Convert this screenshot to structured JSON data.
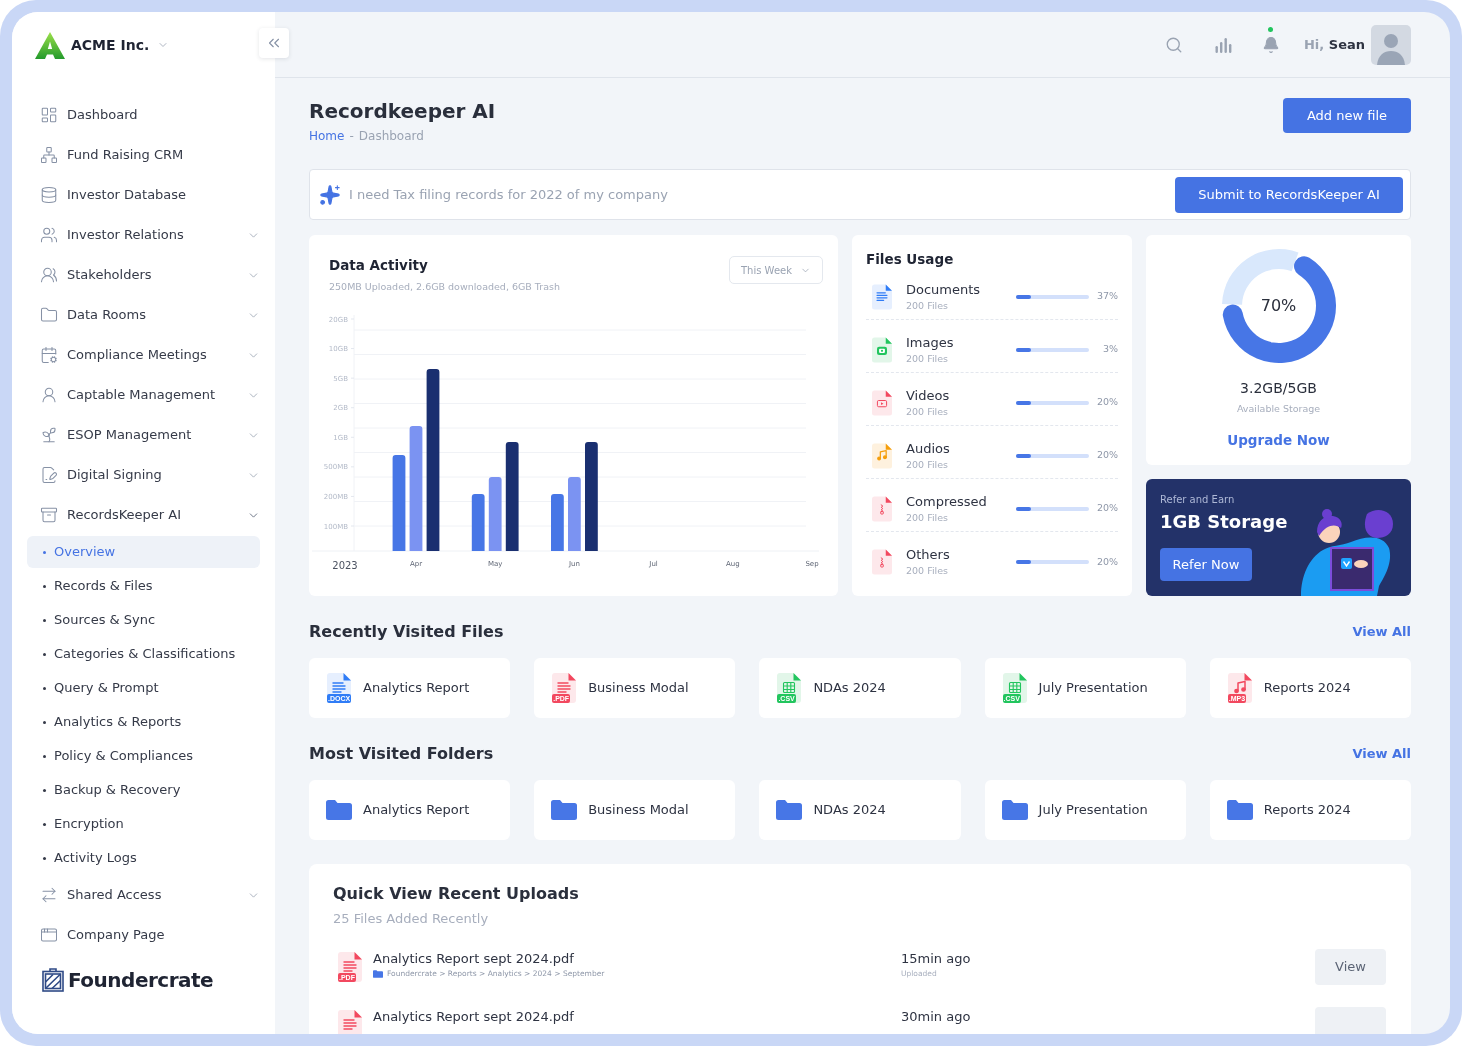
{
  "sidebar": {
    "brand": "ACME Inc.",
    "items": [
      {
        "label": "Dashboard",
        "selected": false
      },
      {
        "label": "Fund Raising CRM",
        "selected": false
      },
      {
        "label": "Investor Database",
        "selected": false
      },
      {
        "label": "Investor Relations",
        "selected": false,
        "expanded": false
      },
      {
        "label": "Stakeholders",
        "selected": false,
        "expanded": false
      },
      {
        "label": "Data Rooms",
        "selected": false,
        "expanded": false
      },
      {
        "label": "Compliance Meetings",
        "selected": false,
        "expanded": false
      },
      {
        "label": "Captable Management",
        "selected": false,
        "expanded": false
      },
      {
        "label": "ESOP Management",
        "selected": false,
        "expanded": false
      },
      {
        "label": "Digital Signing",
        "selected": false,
        "expanded": false
      },
      {
        "label": "RecordsKeeper AI",
        "selected": false,
        "expanded": true,
        "children": [
          {
            "label": "Overview",
            "selected": true
          },
          {
            "label": "Records & Files",
            "selected": false
          },
          {
            "label": "Sources & Sync",
            "selected": false
          },
          {
            "label": "Categories & Classifications",
            "selected": false
          },
          {
            "label": "Query & Prompt",
            "selected": false
          },
          {
            "label": "Analytics & Reports",
            "selected": false
          },
          {
            "label": "Policy & Compliances",
            "selected": false
          },
          {
            "label": "Backup & Recovery",
            "selected": false
          },
          {
            "label": "Encryption",
            "selected": false
          },
          {
            "label": "Activity Logs",
            "selected": false
          }
        ]
      },
      {
        "label": "Shared Access",
        "selected": false,
        "expanded": false
      },
      {
        "label": "Company Page",
        "selected": false
      }
    ],
    "footer_logo": "Foundercrate"
  },
  "header": {
    "notification_dot": true,
    "greeting": "Hi, **Sean**"
  },
  "page": {
    "title": "Recordkeeper AI",
    "breadcrumb": [
      "Home",
      "Dashboard"
    ],
    "breadcrumb_separator": "-",
    "button": "Add new file"
  },
  "prompt": {
    "placeholder": "I need Tax filing records for 2022 of my company",
    "button": "Submit to RecordsKeeper AI"
  },
  "data_activity": {
    "title": "Data Activity",
    "subtitle": "250MB Uploaded, 2.6GB downloaded, 6GB Trash",
    "period": "This Week",
    "y_axis_labels": [
      "20GB",
      "10GB",
      "5GB",
      "2GB",
      "1GB",
      "500MB",
      "200MB",
      "100MB"
    ],
    "x_axis_labels": [
      "Apr",
      "May",
      "Jun",
      "Jul",
      "Aug",
      "Sep"
    ],
    "year": "2023"
  },
  "files_usage": {
    "title": "Files Usage",
    "rows": [
      {
        "kind": "document",
        "name": "Documents",
        "count": "200 Files",
        "level": 0.2,
        "percent": "37%"
      },
      {
        "kind": "image",
        "name": "Images",
        "count": "200 Files",
        "level": 0.2,
        "percent": "3%"
      },
      {
        "kind": "video",
        "name": "Videos",
        "count": "200 Files",
        "level": 0.2,
        "percent": "20%"
      },
      {
        "kind": "audio",
        "name": "Audios",
        "count": "200 Files",
        "level": 0.2,
        "percent": "20%"
      },
      {
        "kind": "archive",
        "name": "Compressed",
        "count": "200 Files",
        "level": 0.2,
        "percent": "20%"
      },
      {
        "kind": "archive",
        "name": "Others",
        "count": "200 Files",
        "level": 0.2,
        "percent": "20%"
      }
    ]
  },
  "storage": {
    "chart_data": {
      "type": "donut",
      "values": [
        70,
        30
      ]
    },
    "percent": "70%",
    "amount": "3.2GB/5GB",
    "caption": "Available Storage",
    "link": "Upgrade Now"
  },
  "referral": {
    "eyebrow": "Refer and Earn",
    "title": "1GB Storage",
    "button": "Refer Now"
  },
  "recent_files": {
    "title": "Recently Visited Files",
    "link": "View All",
    "items": [
      {
        "kind": "docx",
        "badge": ".DOCX",
        "name": "Analytics Report"
      },
      {
        "kind": "pdf",
        "badge": ".PDF",
        "name": "Business Modal"
      },
      {
        "kind": "csv",
        "badge": ".CSV",
        "name": "NDAs 2024"
      },
      {
        "kind": "csv",
        "badge": ".CSV",
        "name": "July Presentation"
      },
      {
        "kind": "mp3",
        "badge": ".MP3",
        "name": "Reports 2024"
      }
    ]
  },
  "folders": {
    "title": "Most Visited Folders",
    "link": "View All",
    "items": [
      {
        "name": "Analytics Report"
      },
      {
        "name": "Business Modal"
      },
      {
        "name": "NDAs 2024"
      },
      {
        "name": "July Presentation"
      },
      {
        "name": "Reports 2024"
      }
    ]
  },
  "uploads": {
    "title": "Quick View Recent Uploads",
    "subtitle": "25 Files Added Recently",
    "rows": [
      {
        "kind": "pdf",
        "badge": ".PDF",
        "name": "Analytics Report sept 2024.pdf",
        "path": "Foundercrate > Reports > Analytics > 2024 > September",
        "time": "15min ago",
        "status": "Uploaded",
        "action": "View"
      },
      {
        "kind": "pdf",
        "name": "Analytics Report sept 2024.pdf",
        "time": "30min ago"
      }
    ]
  }
}
